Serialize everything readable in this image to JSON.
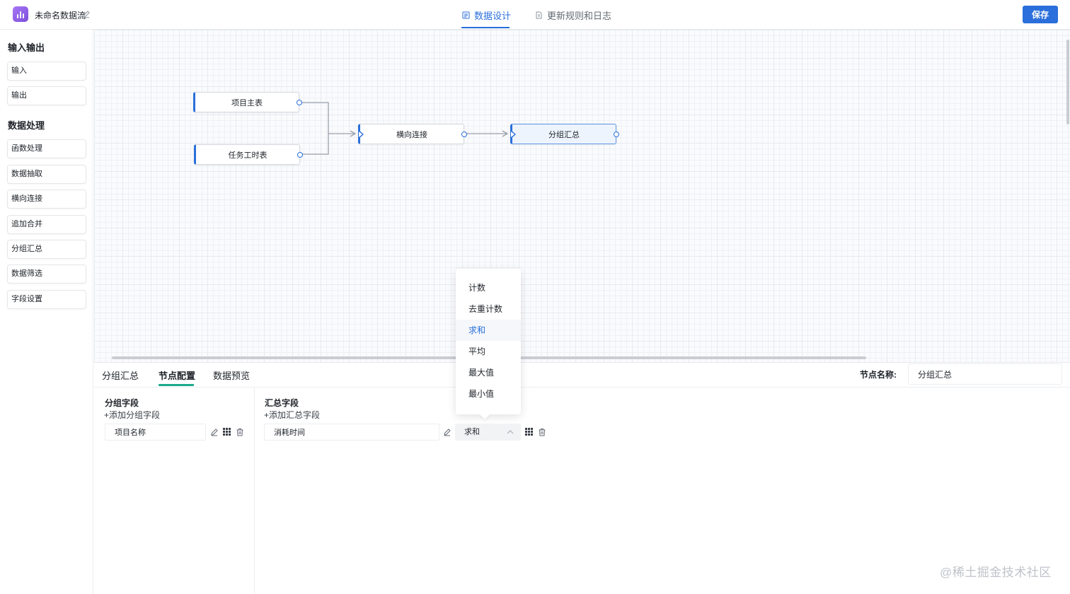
{
  "header": {
    "title": "未命名数据流",
    "tabs": [
      {
        "label": "数据设计",
        "active": true
      },
      {
        "label": "更新规则和日志",
        "active": false
      }
    ],
    "save_label": "保存"
  },
  "sidebar": {
    "sections": [
      {
        "title": "输入输出",
        "items": [
          "输入",
          "输出"
        ]
      },
      {
        "title": "数据处理",
        "items": [
          "函数处理",
          "数据抽取",
          "横向连接",
          "追加合并",
          "分组汇总",
          "数据筛选",
          "字段设置"
        ]
      }
    ]
  },
  "canvas": {
    "nodes": [
      {
        "label": "项目主表"
      },
      {
        "label": "任务工时表"
      },
      {
        "label": "横向连接"
      },
      {
        "label": "分组汇总",
        "selected": true
      }
    ]
  },
  "panel": {
    "tabs": [
      "分组汇总",
      "节点配置",
      "数据预览"
    ],
    "active_tab": "节点配置",
    "node_name_label": "节点名称:",
    "node_name_value": "分组汇总",
    "group_title": "分组字段",
    "group_add": "+添加分组字段",
    "group_field": "项目名称",
    "summary_title": "汇总字段",
    "summary_add": "+添加汇总字段",
    "summary_field": "消耗时间",
    "agg_value": "求和"
  },
  "dropdown": {
    "options": [
      "计数",
      "去重计数",
      "求和",
      "平均",
      "最大值",
      "最小值"
    ],
    "selected": "求和"
  },
  "watermark": "@稀土掘金技术社区",
  "colors": {
    "accent": "#2a6fdb",
    "tab_underline": "#1bab8a"
  }
}
